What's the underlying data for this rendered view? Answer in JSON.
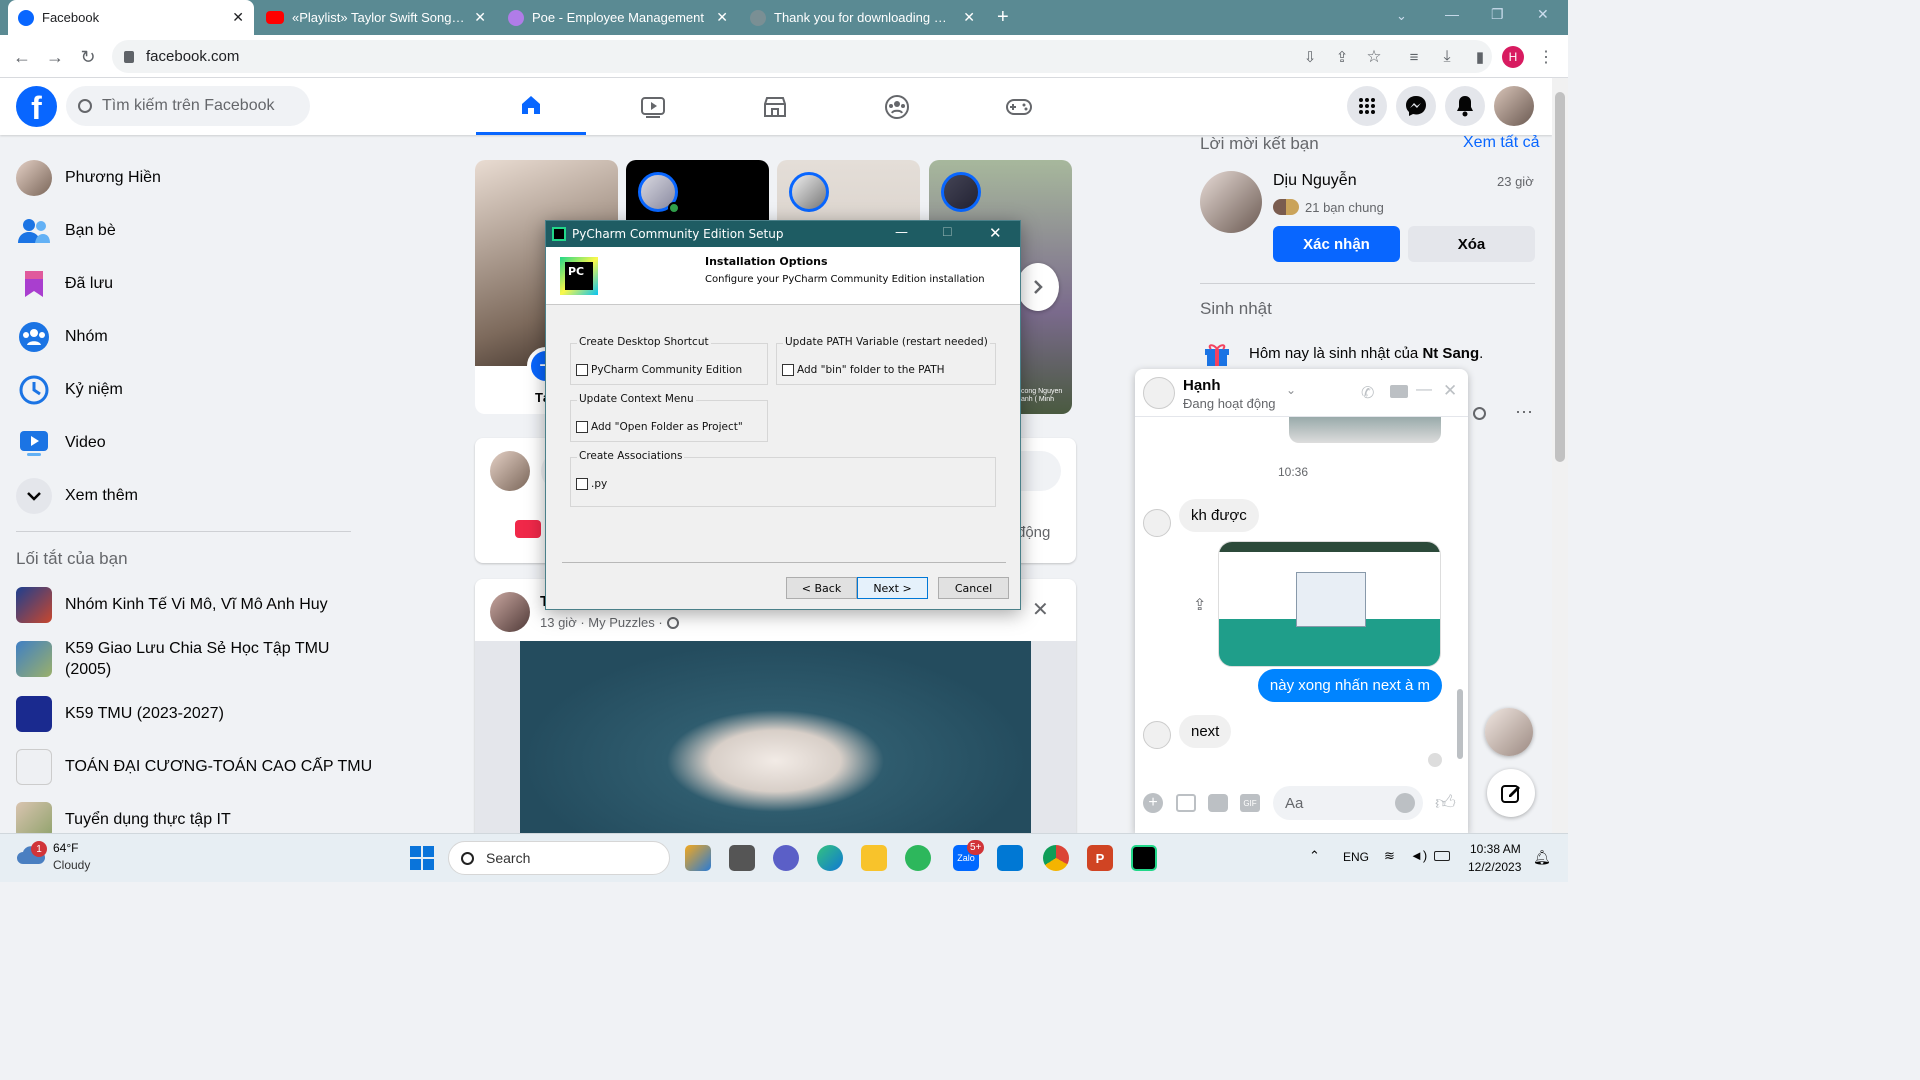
{
  "browser": {
    "tabs": [
      {
        "title": "Facebook",
        "active": true
      },
      {
        "title": "«Playlist» Taylor Swift Songs Playlist",
        "active": false
      },
      {
        "title": "Poe - Employee Management",
        "active": false
      },
      {
        "title": "Thank you for downloading PyCharm",
        "active": false
      }
    ],
    "url": "facebook.com",
    "profile_initial": "H"
  },
  "fb": {
    "search_placeholder": "Tìm kiếm trên Facebook",
    "sidebar": [
      {
        "label": "Phương Hiền",
        "icon": "avatar"
      },
      {
        "label": "Bạn bè",
        "icon": "friends-icon"
      },
      {
        "label": "Đã lưu",
        "icon": "bookmark-icon"
      },
      {
        "label": "Nhóm",
        "icon": "groups-icon"
      },
      {
        "label": "Kỷ niệm",
        "icon": "memories-icon"
      },
      {
        "label": "Video",
        "icon": "video-icon"
      },
      {
        "label": "Xem thêm",
        "icon": "chevron-down-icon"
      }
    ],
    "shortcuts_title": "Lối tắt của bạn",
    "shortcuts": [
      {
        "label": "Nhóm Kinh Tế Vi Mô, Vĩ Mô Anh Huy"
      },
      {
        "label": "K59 Giao Lưu Chia Sẻ Học Tập TMU (2005)"
      },
      {
        "label": "K59 TMU (2023-2027)"
      },
      {
        "label": "TOÁN ĐẠI CƯƠNG-TOÁN CAO CẤP TMU"
      },
      {
        "label": "Tuyển dụng thực tập IT"
      }
    ],
    "story_create_label": "Tạo",
    "story_caption": "cong Nguyen\nanh ( Minh",
    "composer_action": "động",
    "post": {
      "author_initial": "T",
      "meta": "13 giờ · My Puzzles ·"
    },
    "friend_requests": {
      "title": "Lời mời kết bạn",
      "see_all": "Xem tất cả",
      "name": "Dịu Nguyễn",
      "time": "23 giờ",
      "mutual": "21 bạn chung",
      "confirm": "Xác nhận",
      "delete": "Xóa"
    },
    "birthdays": {
      "title": "Sinh nhật",
      "text_prefix": "Hôm nay là sinh nhật của ",
      "name": "Nt Sang",
      "text_suffix": "."
    }
  },
  "chat": {
    "name": "Hạnh",
    "status": "Đang hoạt động",
    "time": "10:36",
    "messages": [
      {
        "from": "them",
        "text": "kh được"
      },
      {
        "from": "me",
        "text": "này xong nhấn next à m"
      },
      {
        "from": "them",
        "text": "next"
      }
    ],
    "input_placeholder": "Aa"
  },
  "dialog": {
    "title": "PyCharm Community Edition Setup",
    "header_title": "Installation Options",
    "header_sub": "Configure your PyCharm Community Edition installation",
    "groups": {
      "shortcut": {
        "label": "Create Desktop Shortcut",
        "option": "PyCharm Community Edition"
      },
      "path": {
        "label": "Update PATH Variable (restart needed)",
        "option": "Add \"bin\" folder to the PATH"
      },
      "context": {
        "label": "Update Context Menu",
        "option": "Add \"Open Folder as Project\""
      },
      "assoc": {
        "label": "Create Associations",
        "option": ".py"
      }
    },
    "buttons": {
      "back": "< Back",
      "next": "Next >",
      "cancel": "Cancel"
    }
  },
  "taskbar": {
    "weather_temp": "64°F",
    "weather_desc": "Cloudy",
    "weather_badge": "1",
    "search": "Search",
    "zalo_badge": "5+",
    "lang": "ENG",
    "time": "10:38 AM",
    "date": "12/2/2023"
  }
}
